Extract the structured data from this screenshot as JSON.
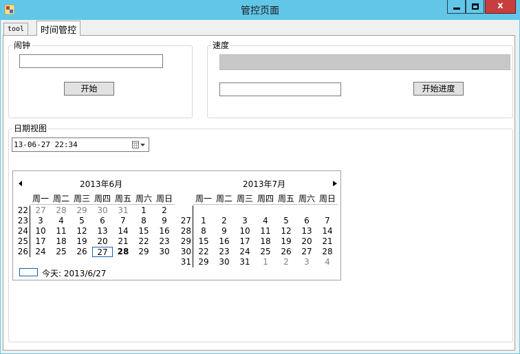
{
  "window": {
    "title": "管控页面",
    "close_label": "x"
  },
  "tabs": [
    {
      "label": "tool"
    },
    {
      "label": "时间管控"
    }
  ],
  "alarm": {
    "group_title": "闹钟",
    "input_value": "",
    "start_label": "开始"
  },
  "speed": {
    "group_title": "速度",
    "progress": 0,
    "input_value": "",
    "start_label": "开始进度"
  },
  "date_view": {
    "group_title": "日期视图",
    "picker_value": "13-06-27  22:34"
  },
  "calendar": {
    "weekdays": [
      "周一",
      "周二",
      "周三",
      "周四",
      "周五",
      "周六",
      "周日"
    ],
    "today_label": "今天: 2013/6/27",
    "months": [
      {
        "title": "2013年6月",
        "weeks": [
          {
            "wk": "22",
            "days": [
              {
                "d": "27",
                "gray": true
              },
              {
                "d": "28",
                "gray": true
              },
              {
                "d": "29",
                "gray": true
              },
              {
                "d": "30",
                "gray": true
              },
              {
                "d": "31",
                "gray": true
              },
              {
                "d": "1"
              },
              {
                "d": "2"
              }
            ]
          },
          {
            "wk": "23",
            "days": [
              {
                "d": "3"
              },
              {
                "d": "4"
              },
              {
                "d": "5"
              },
              {
                "d": "6"
              },
              {
                "d": "7"
              },
              {
                "d": "8"
              },
              {
                "d": "9"
              }
            ]
          },
          {
            "wk": "24",
            "days": [
              {
                "d": "10"
              },
              {
                "d": "11"
              },
              {
                "d": "12"
              },
              {
                "d": "13"
              },
              {
                "d": "14"
              },
              {
                "d": "15"
              },
              {
                "d": "16"
              }
            ]
          },
          {
            "wk": "25",
            "days": [
              {
                "d": "17"
              },
              {
                "d": "18"
              },
              {
                "d": "19"
              },
              {
                "d": "20"
              },
              {
                "d": "21"
              },
              {
                "d": "22"
              },
              {
                "d": "23"
              }
            ]
          },
          {
            "wk": "26",
            "days": [
              {
                "d": "24"
              },
              {
                "d": "25"
              },
              {
                "d": "26"
              },
              {
                "d": "27",
                "today": true
              },
              {
                "d": "28",
                "bold": true
              },
              {
                "d": "29"
              },
              {
                "d": "30"
              }
            ]
          }
        ]
      },
      {
        "title": "2013年7月",
        "weeks": [
          {
            "wk": "27",
            "days": [
              {
                "d": "1"
              },
              {
                "d": "2"
              },
              {
                "d": "3"
              },
              {
                "d": "4"
              },
              {
                "d": "5"
              },
              {
                "d": "6"
              },
              {
                "d": "7"
              }
            ]
          },
          {
            "wk": "28",
            "days": [
              {
                "d": "8"
              },
              {
                "d": "9"
              },
              {
                "d": "10"
              },
              {
                "d": "11"
              },
              {
                "d": "12"
              },
              {
                "d": "13"
              },
              {
                "d": "14"
              }
            ]
          },
          {
            "wk": "29",
            "days": [
              {
                "d": "15"
              },
              {
                "d": "16"
              },
              {
                "d": "17"
              },
              {
                "d": "18"
              },
              {
                "d": "19"
              },
              {
                "d": "20"
              },
              {
                "d": "21"
              }
            ]
          },
          {
            "wk": "30",
            "days": [
              {
                "d": "22"
              },
              {
                "d": "23"
              },
              {
                "d": "24"
              },
              {
                "d": "25"
              },
              {
                "d": "26"
              },
              {
                "d": "27"
              },
              {
                "d": "28"
              }
            ]
          },
          {
            "wk": "31",
            "days": [
              {
                "d": "29"
              },
              {
                "d": "30"
              },
              {
                "d": "31"
              },
              {
                "d": "1",
                "gray": true
              },
              {
                "d": "2",
                "gray": true
              },
              {
                "d": "3",
                "gray": true
              },
              {
                "d": "4",
                "gray": true
              }
            ]
          }
        ]
      }
    ]
  },
  "colors": {
    "titlebar": "#62c6e8",
    "close_button": "#c83d3d",
    "today_border": "#1c5ca8",
    "progress_track": "#c8c8c8"
  }
}
